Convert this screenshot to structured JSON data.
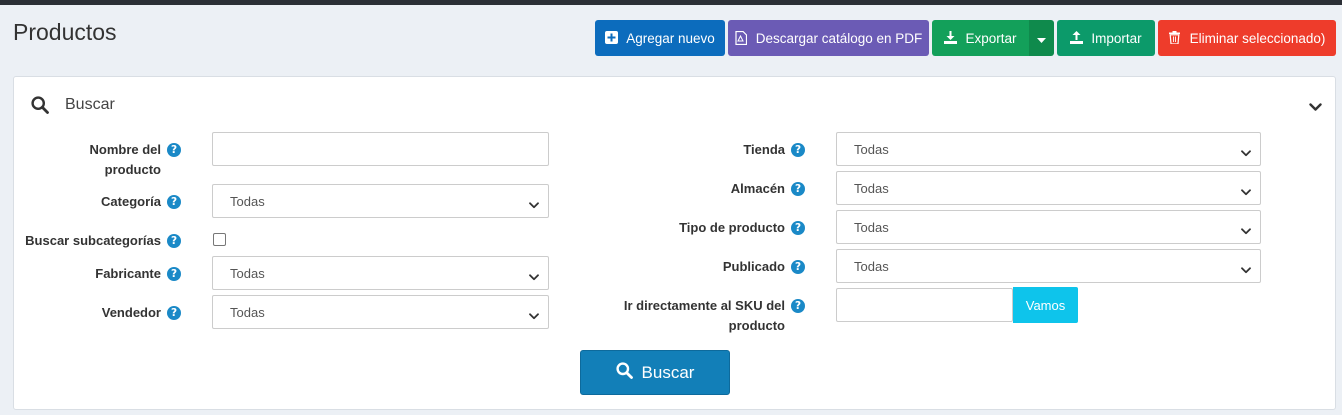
{
  "page": {
    "title": "Productos"
  },
  "toolbar": {
    "add_new": "Agregar nuevo",
    "download_pdf": "Descargar catálogo en PDF",
    "export": "Exportar",
    "import": "Importar",
    "delete_selected": "Eliminar seleccionado)"
  },
  "search_panel": {
    "title": "Buscar",
    "help_glyph": "?",
    "left": {
      "product_name": {
        "label": "Nombre del producto",
        "value": ""
      },
      "category": {
        "label": "Categoría",
        "value": "Todas"
      },
      "search_subcategories": {
        "label": "Buscar subcategorías",
        "checked": false
      },
      "manufacturer": {
        "label": "Fabricante",
        "value": "Todas"
      },
      "vendor": {
        "label": "Vendedor",
        "value": "Todas"
      }
    },
    "right": {
      "store": {
        "label": "Tienda",
        "value": "Todas"
      },
      "warehouse": {
        "label": "Almacén",
        "value": "Todas"
      },
      "product_type": {
        "label": "Tipo de producto",
        "value": "Todas"
      },
      "published": {
        "label": "Publicado",
        "value": "Todas"
      },
      "sku": {
        "label": "Ir directamente al SKU del producto",
        "value": "",
        "go_label": "Vamos"
      }
    },
    "search_button": "Buscar"
  },
  "colors": {
    "blue": "#0c6cbd",
    "purple": "#6b5bb5",
    "green": "#13a05a",
    "teal": "#0c9a6a",
    "red": "#ee3c2b",
    "help_icon": "#1a89c7",
    "go_button": "#0ec4eb",
    "search_button": "#127fb8"
  }
}
